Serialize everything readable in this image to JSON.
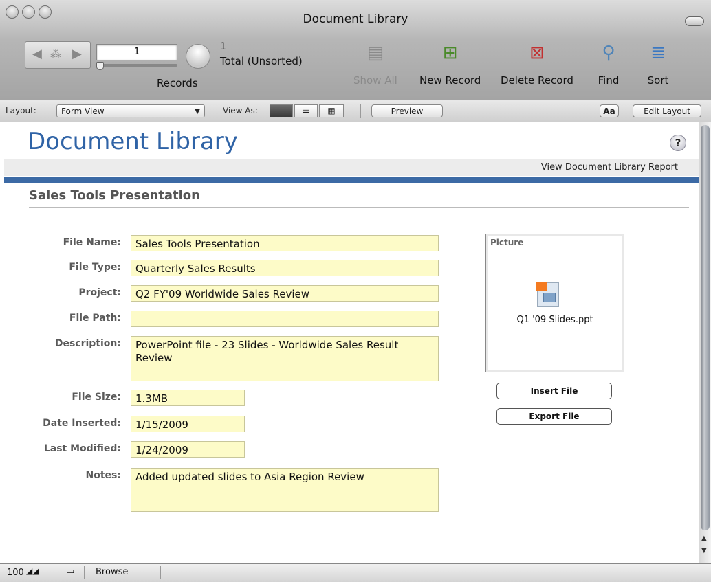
{
  "window": {
    "title": "Document Library"
  },
  "toolbar": {
    "record_number": "1",
    "record_count": "1",
    "record_status": "Total (Unsorted)",
    "records_label": "Records",
    "buttons": [
      {
        "label": "Show All",
        "icon": "show-all-icon",
        "enabled": false
      },
      {
        "label": "New Record",
        "icon": "new-record-icon",
        "enabled": true
      },
      {
        "label": "Delete Record",
        "icon": "delete-record-icon",
        "enabled": true
      },
      {
        "label": "Find",
        "icon": "magnifier-icon",
        "enabled": true
      },
      {
        "label": "Sort",
        "icon": "sort-icon",
        "enabled": true
      }
    ]
  },
  "layoutbar": {
    "layout_label": "Layout:",
    "layout_value": "Form View",
    "view_as_label": "View As:",
    "preview_label": "Preview",
    "text_format_label": "Aa",
    "edit_layout_label": "Edit Layout"
  },
  "content": {
    "title": "Document Library",
    "help_icon": "?",
    "report_link": "View Document Library Report",
    "section_title": "Sales Tools Presentation",
    "fields": {
      "file_name": {
        "label": "File Name:",
        "value": "Sales Tools Presentation"
      },
      "file_type": {
        "label": "File Type:",
        "value": "Quarterly Sales Results"
      },
      "project": {
        "label": "Project:",
        "value": "Q2 FY'09 Worldwide Sales Review"
      },
      "file_path": {
        "label": "File Path:",
        "value": ""
      },
      "description": {
        "label": "Description:",
        "value": "PowerPoint file - 23 Slides - Worldwide Sales Result Review"
      },
      "file_size": {
        "label": "File Size:",
        "value": "1.3MB"
      },
      "date_inserted": {
        "label": "Date Inserted:",
        "value": "1/15/2009"
      },
      "last_modified": {
        "label": "Last Modified:",
        "value": "1/24/2009"
      },
      "notes": {
        "label": "Notes:",
        "value": "Added updated slides to Asia Region Review"
      }
    },
    "picture": {
      "label": "Picture",
      "file_name": "Q1 '09 Slides.ppt"
    },
    "insert_file_label": "Insert File",
    "export_file_label": "Export File"
  },
  "statusbar": {
    "zoom": "100",
    "mode": "Browse"
  },
  "colors": {
    "title_blue": "#2f63a6",
    "band_blue": "#3c6aa5",
    "field_yellow": "#fdfbc8"
  }
}
